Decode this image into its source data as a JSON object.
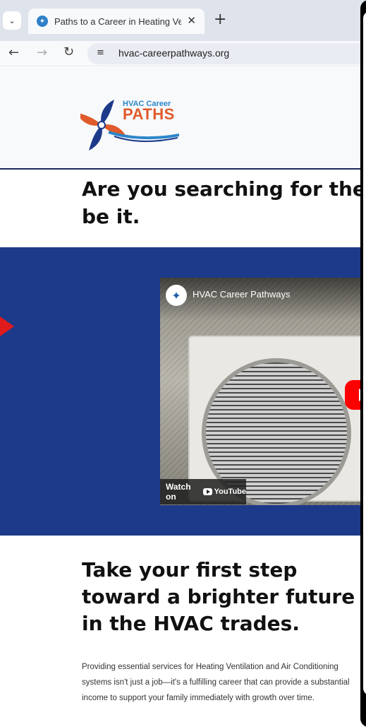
{
  "browser": {
    "tab_title": "Paths to a Career in Heating Ve",
    "url": "hvac-careerpathways.org"
  },
  "logo": {
    "small_text": "HVAC Career",
    "big_text": "PATHS"
  },
  "hero": {
    "heading_line1": "Are you searching for the r",
    "heading_line2": "be it."
  },
  "video": {
    "channel_title": "HVAC Career Pathways",
    "watch_on": "Watch on",
    "youtube": "YouTube"
  },
  "section": {
    "heading": "Take your first step toward a brighter future in the HVAC trades.",
    "body": "Providing essential services for Heating Ventilation and Air Conditioning systems isn't just a job—it's a fulfilling career that can provide a substantial income to support your family immediately with growth over time."
  },
  "colors": {
    "band": "#1d3a8a",
    "logo_blue": "#2c86c9",
    "logo_orange": "#e05a2b",
    "arrow": "#e01b1b"
  },
  "icons": [
    "tab-menu-icon",
    "site-favicon-icon",
    "close-icon",
    "plus-icon",
    "back-arrow-icon",
    "forward-arrow-icon",
    "reload-icon",
    "site-settings-icon",
    "fan-logo-icon",
    "play-icon",
    "youtube-icon"
  ]
}
